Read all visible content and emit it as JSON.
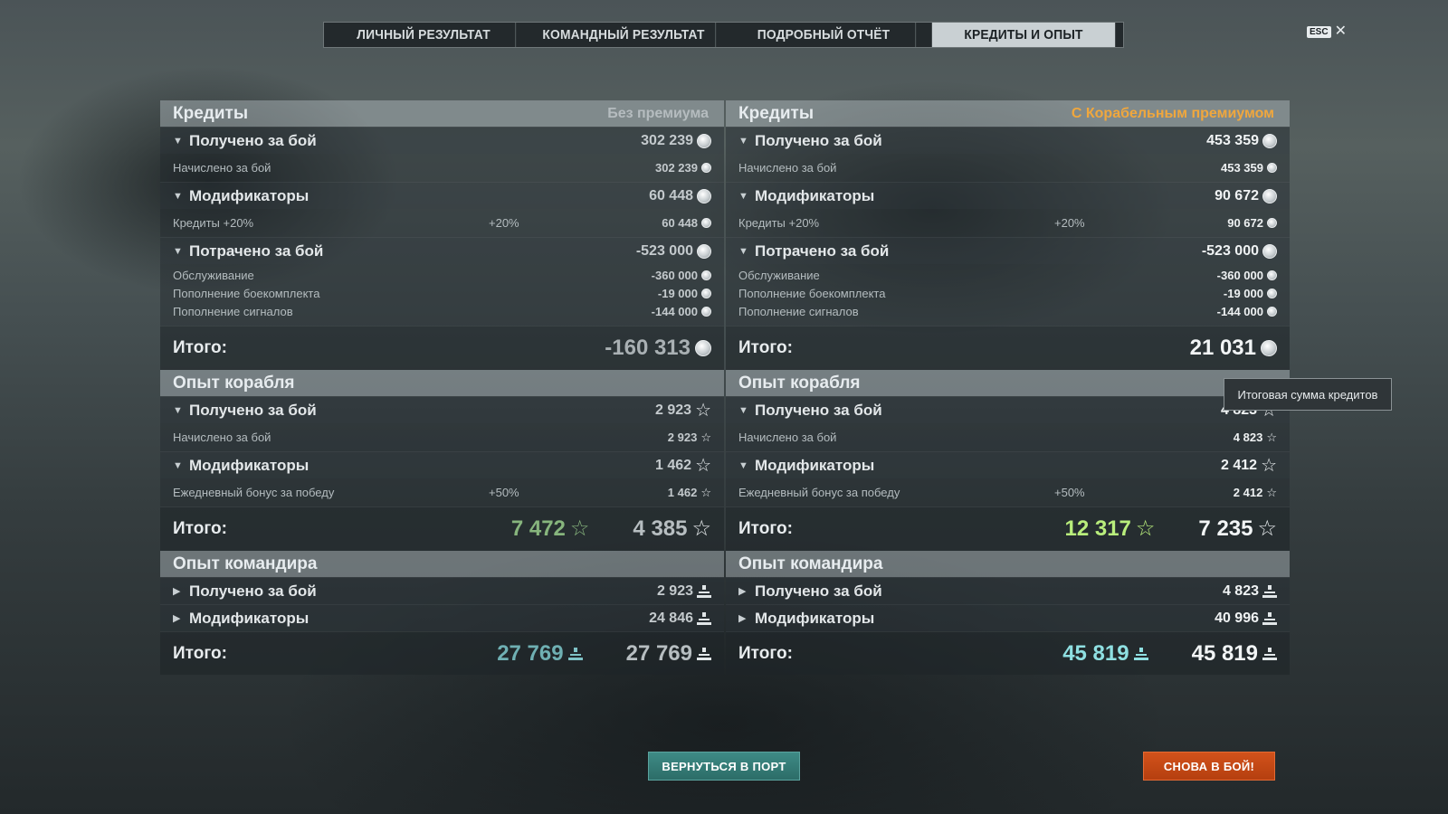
{
  "tabs": [
    "ЛИЧНЫЙ РЕЗУЛЬТАТ",
    "КОМАНДНЫЙ РЕЗУЛЬТАТ",
    "ПОДРОБНЫЙ ОТЧЁТ",
    "КРЕДИТЫ И ОПЫТ"
  ],
  "active_tab": 3,
  "esc_label": "ESC",
  "tooltip": "Итоговая сумма кредитов",
  "buttons": {
    "port": "ВЕРНУТЬСЯ В ПОРТ",
    "battle": "СНОВА В БОЙ!"
  },
  "colors": {
    "premium_gold": "#f0a73d",
    "xp_green": "#87b57d",
    "xp_green_bright": "#b9ee7c",
    "cmd_teal": "#6fb0b3",
    "cmd_teal_bright": "#8fe0e2",
    "port_button": "#2c6d68",
    "battle_button": "#c84a16"
  },
  "left": {
    "credits_title": "Кредиты",
    "credits_sub": "Без премиума",
    "received": {
      "label": "Получено за бой",
      "value": "302 239"
    },
    "received_detail": {
      "label": "Начислено за бой",
      "value": "302 239"
    },
    "modifiers": {
      "label": "Модификаторы",
      "value": "60 448"
    },
    "modifier_detail": {
      "label": "Кредиты +20%",
      "pct": "+20%",
      "value": "60 448"
    },
    "spent": {
      "label": "Потрачено за бой",
      "value": "-523 000"
    },
    "spent_items": [
      {
        "label": "Обслуживание",
        "value": "-360 000"
      },
      {
        "label": "Пополнение боекомплекта",
        "value": "-19 000"
      },
      {
        "label": "Пополнение сигналов",
        "value": "-144 000"
      }
    ],
    "credits_total": {
      "label": "Итого:",
      "value": "-160 313"
    },
    "xp_title": "Опыт корабля",
    "xp_received": {
      "label": "Получено за бой",
      "value": "2 923"
    },
    "xp_received_detail": {
      "label": "Начислено за бой",
      "value": "2 923"
    },
    "xp_modifiers": {
      "label": "Модификаторы",
      "value": "1 462"
    },
    "xp_modifier_detail": {
      "label": "Ежедневный бонус за победу",
      "pct": "+50%",
      "value": "1 462"
    },
    "xp_total": {
      "label": "Итого:",
      "value_alt": "7 472",
      "value": "4 385"
    },
    "cmd_title": "Опыт командира",
    "cmd_received": {
      "label": "Получено за бой",
      "value": "2 923"
    },
    "cmd_modifiers": {
      "label": "Модификаторы",
      "value": "24 846"
    },
    "cmd_total": {
      "label": "Итого:",
      "value_alt": "27 769",
      "value": "27 769"
    }
  },
  "right": {
    "credits_title": "Кредиты",
    "credits_sub": "С Корабельным премиумом",
    "received": {
      "label": "Получено за бой",
      "value": "453 359"
    },
    "received_detail": {
      "label": "Начислено за бой",
      "value": "453 359"
    },
    "modifiers": {
      "label": "Модификаторы",
      "value": "90 672"
    },
    "modifier_detail": {
      "label": "Кредиты +20%",
      "pct": "+20%",
      "value": "90 672"
    },
    "spent": {
      "label": "Потрачено за бой",
      "value": "-523 000"
    },
    "spent_items": [
      {
        "label": "Обслуживание",
        "value": "-360 000"
      },
      {
        "label": "Пополнение боекомплекта",
        "value": "-19 000"
      },
      {
        "label": "Пополнение сигналов",
        "value": "-144 000"
      }
    ],
    "credits_total": {
      "label": "Итого:",
      "value": "21 031"
    },
    "xp_title": "Опыт корабля",
    "xp_received": {
      "label": "Получено за бой",
      "value": "4 823"
    },
    "xp_received_detail": {
      "label": "Начислено за бой",
      "value": "4 823"
    },
    "xp_modifiers": {
      "label": "Модификаторы",
      "value": "2 412"
    },
    "xp_modifier_detail": {
      "label": "Ежедневный бонус за победу",
      "pct": "+50%",
      "value": "2 412"
    },
    "xp_total": {
      "label": "Итого:",
      "value_alt": "12 317",
      "value": "7 235"
    },
    "cmd_title": "Опыт командира",
    "cmd_received": {
      "label": "Получено за бой",
      "value": "4 823"
    },
    "cmd_modifiers": {
      "label": "Модификаторы",
      "value": "40 996"
    },
    "cmd_total": {
      "label": "Итого:",
      "value_alt": "45 819",
      "value": "45 819"
    }
  }
}
